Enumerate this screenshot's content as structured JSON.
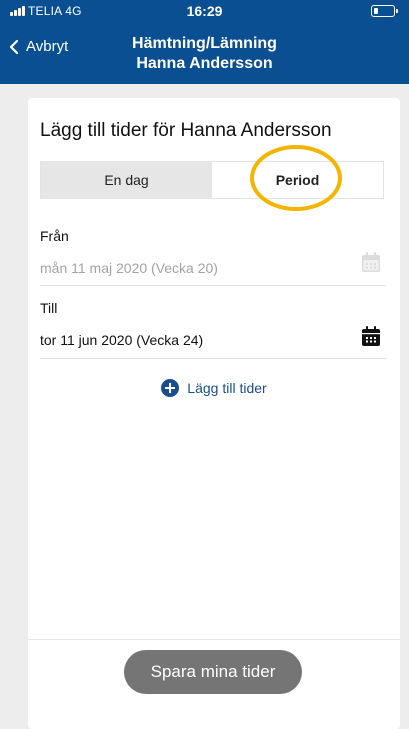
{
  "status_bar": {
    "carrier": "TELIA  4G",
    "time": "16:29",
    "battery_percent": 20
  },
  "nav": {
    "back_label": "Avbryt",
    "title_line1": "Hämtning/Lämning",
    "title_line2": "Hanna Andersson"
  },
  "card": {
    "title": "Lägg till tider för Hanna Andersson",
    "segments": [
      {
        "label": "En dag",
        "selected": false
      },
      {
        "label": "Period",
        "selected": true
      }
    ],
    "from": {
      "label": "Från",
      "value": "mån 11 maj 2020 (Vecka 20)",
      "icon": "calendar-icon"
    },
    "to": {
      "label": "Till",
      "value": "tor 11 jun 2020 (Vecka 24)",
      "icon": "calendar-icon"
    },
    "add_times_label": "Lägg till tider",
    "save_label": "Spara mina tider"
  },
  "colors": {
    "header": "#0b4f93",
    "accent": "#1a4d8f",
    "highlight": "#f4b400",
    "save_button": "#757575"
  }
}
